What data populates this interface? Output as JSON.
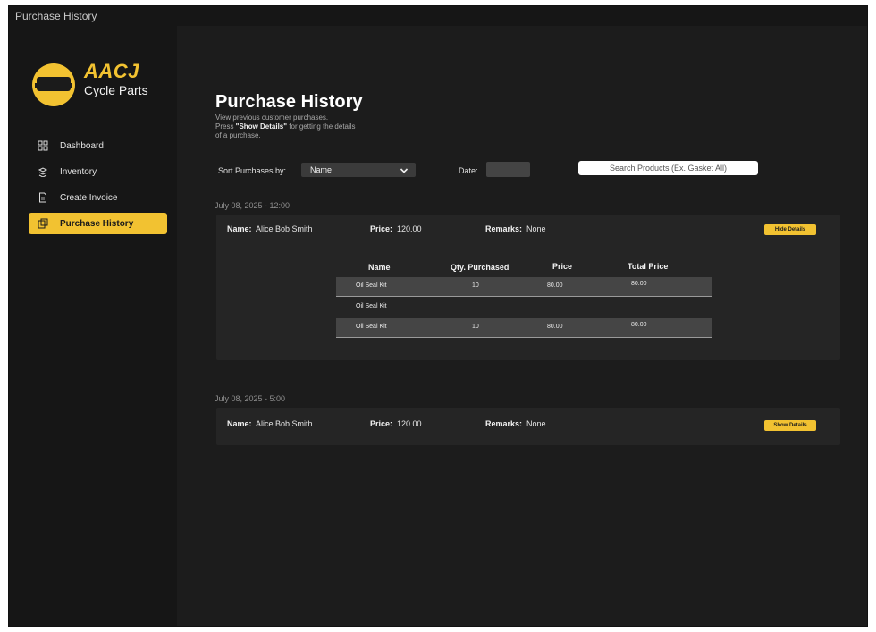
{
  "window": {
    "title": "Purchase History"
  },
  "brand": {
    "name": "AACJ",
    "subtitle": "Cycle Parts"
  },
  "colors": {
    "accent": "#f2c231",
    "background": "#1c1c1c",
    "sidebar": "#161616",
    "card": "#252525"
  },
  "sidebar": {
    "items": [
      {
        "label": "Dashboard",
        "icon": "dashboard-grid-icon",
        "active": false
      },
      {
        "label": "Inventory",
        "icon": "inventory-stack-icon",
        "active": false
      },
      {
        "label": "Create Invoice",
        "icon": "document-icon",
        "active": false
      },
      {
        "label": "Purchase History",
        "icon": "history-icon",
        "active": true
      }
    ]
  },
  "header": {
    "title": "Purchase History",
    "desc_line1": "View previous customer purchases.",
    "desc_press": "Press ",
    "desc_bold": "\"Show Details\"",
    "desc_line2_rest": " for getting the details",
    "desc_line3": "of a purchase."
  },
  "filters": {
    "sort_label": "Sort Purchases  by:",
    "sort_value": "Name",
    "date_label": "Date:",
    "search_placeholder": "Search Products (Ex. Gasket All)"
  },
  "purchases": [
    {
      "datestamp": "July 08, 2025  - 12:00",
      "name_label": "Name:",
      "name": "Alice Bob Smith",
      "price_label": "Price:",
      "price": "120.00",
      "remarks_label": "Remarks:",
      "remarks": "None",
      "button": "Hide Details",
      "table": {
        "headers": [
          "Name",
          "Qty. Purchased",
          "Price",
          "Total Price"
        ],
        "rows": [
          {
            "name": "Oil Seal Kit",
            "qty": "10",
            "price": "80.00",
            "total": "80.00"
          },
          {
            "name": "Oil Seal Kit",
            "qty": "",
            "price": "",
            "total": ""
          },
          {
            "name": "Oil Seal Kit",
            "qty": "10",
            "price": "80.00",
            "total": "80.00"
          }
        ]
      }
    },
    {
      "datestamp": "July 08, 2025  - 5:00",
      "name_label": "Name:",
      "name": "Alice Bob Smith",
      "price_label": "Price:",
      "price": "120.00",
      "remarks_label": "Remarks:",
      "remarks": "None",
      "button": "Show Details"
    }
  ]
}
